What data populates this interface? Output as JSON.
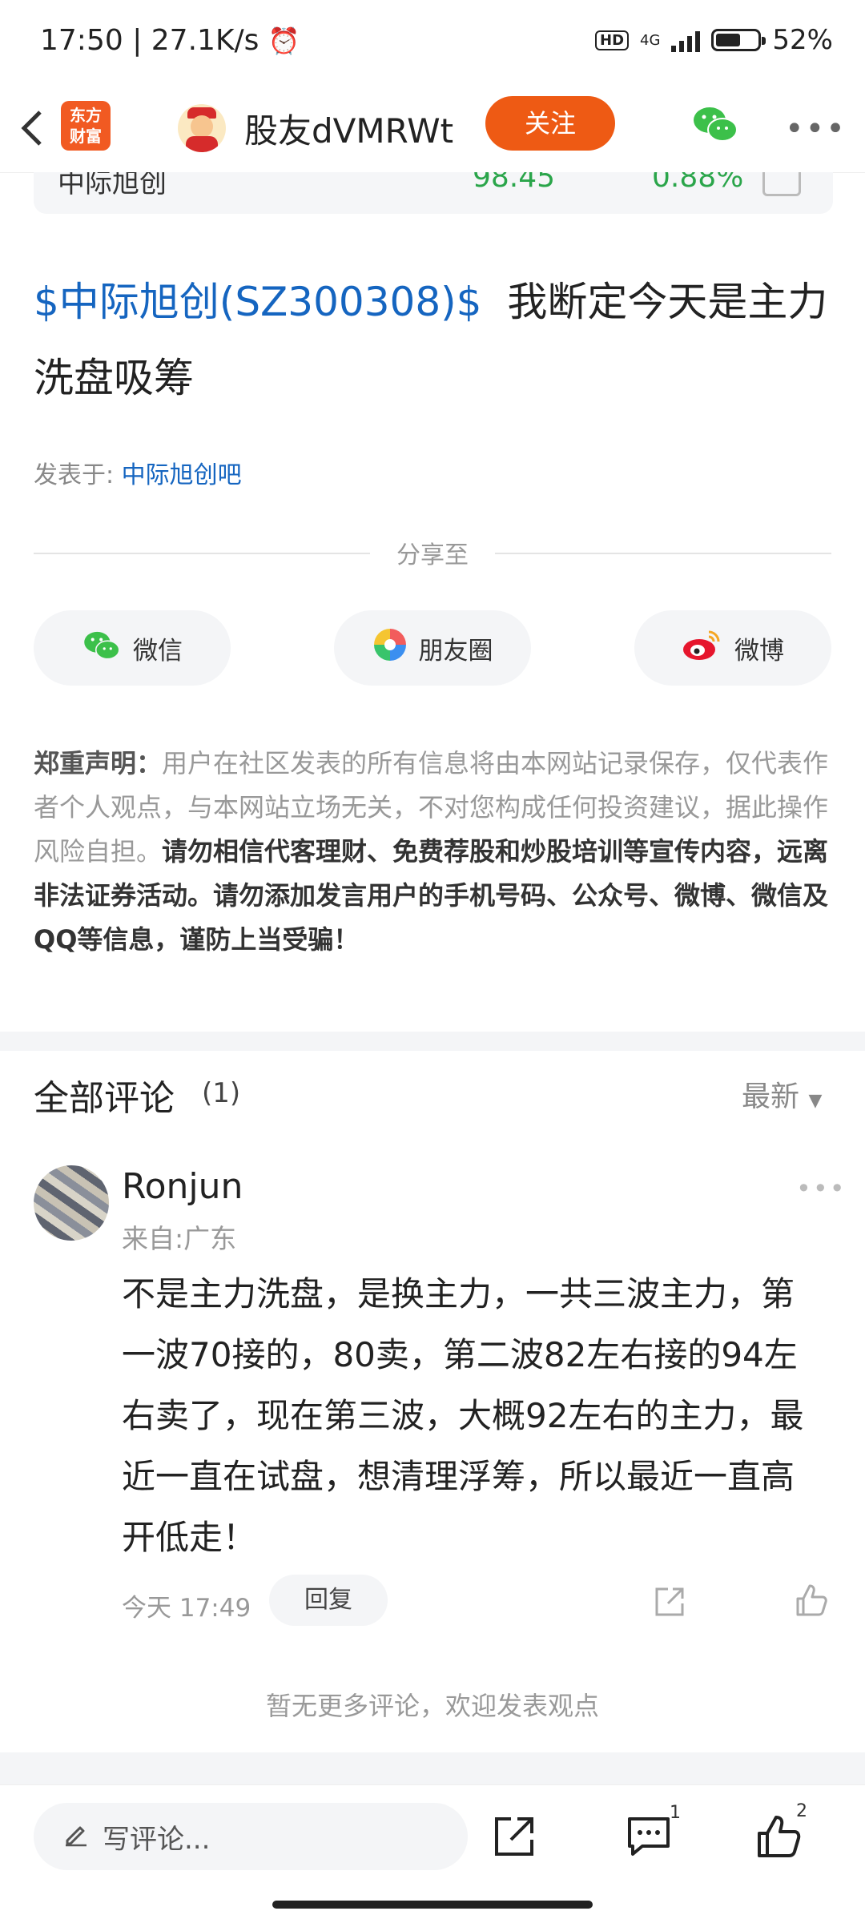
{
  "status_bar": {
    "time": "17:50",
    "net_speed": "27.1K/s",
    "hd": "HD",
    "network": "4G",
    "battery": "52%"
  },
  "nav": {
    "app_logo_line1": "东方",
    "app_logo_line2": "财富",
    "username": "股友dVMRWt",
    "follow_label": "关注"
  },
  "stock_card": {
    "name": "中际旭创",
    "price": "98.45",
    "change": "0.88%"
  },
  "post": {
    "stock_tag": "$中际旭创(SZ300308)$",
    "title_text": "我断定今天是主力洗盘吸筹",
    "source_label": "发表于:",
    "source_link": "中际旭创吧"
  },
  "share": {
    "label": "分享至",
    "buttons": [
      {
        "label": "微信",
        "icon": "wechat-icon"
      },
      {
        "label": "朋友圈",
        "icon": "moments-icon"
      },
      {
        "label": "微博",
        "icon": "weibo-icon"
      }
    ]
  },
  "disclaimer": {
    "heading": "郑重声明：",
    "normal_text": "用户在社区发表的所有信息将由本网站记录保存，仅代表作者个人观点，与本网站立场无关，不对您构成任何投资建议，据此操作风险自担。",
    "bold_text": "请勿相信代客理财、免费荐股和炒股培训等宣传内容，远离非法证券活动。请勿添加发言用户的手机号码、公众号、微博、微信及QQ等信息，谨防上当受骗！"
  },
  "comments": {
    "header": "全部评论",
    "count": "(1)",
    "sort_label": "最新",
    "items": [
      {
        "author": "Ronjun",
        "from": "来自:广东",
        "text": "不是主力洗盘，是换主力，一共三波主力，第一波70接的，80卖，第二波82左右接的94左右卖了，现在第三波，大概92左右的主力，最近一直在试盘，想清理浮筹，所以最近一直高开低走！",
        "time": "今天 17:49",
        "reply_label": "回复"
      }
    ],
    "no_more": "暂无更多评论，欢迎发表观点"
  },
  "bottom_bar": {
    "write_placeholder": "写评论...",
    "comment_count": "1",
    "like_count": "2"
  },
  "colors": {
    "accent_orange": "#ee5a14",
    "link_blue": "#1565c0",
    "stock_green": "#2aa54a"
  }
}
